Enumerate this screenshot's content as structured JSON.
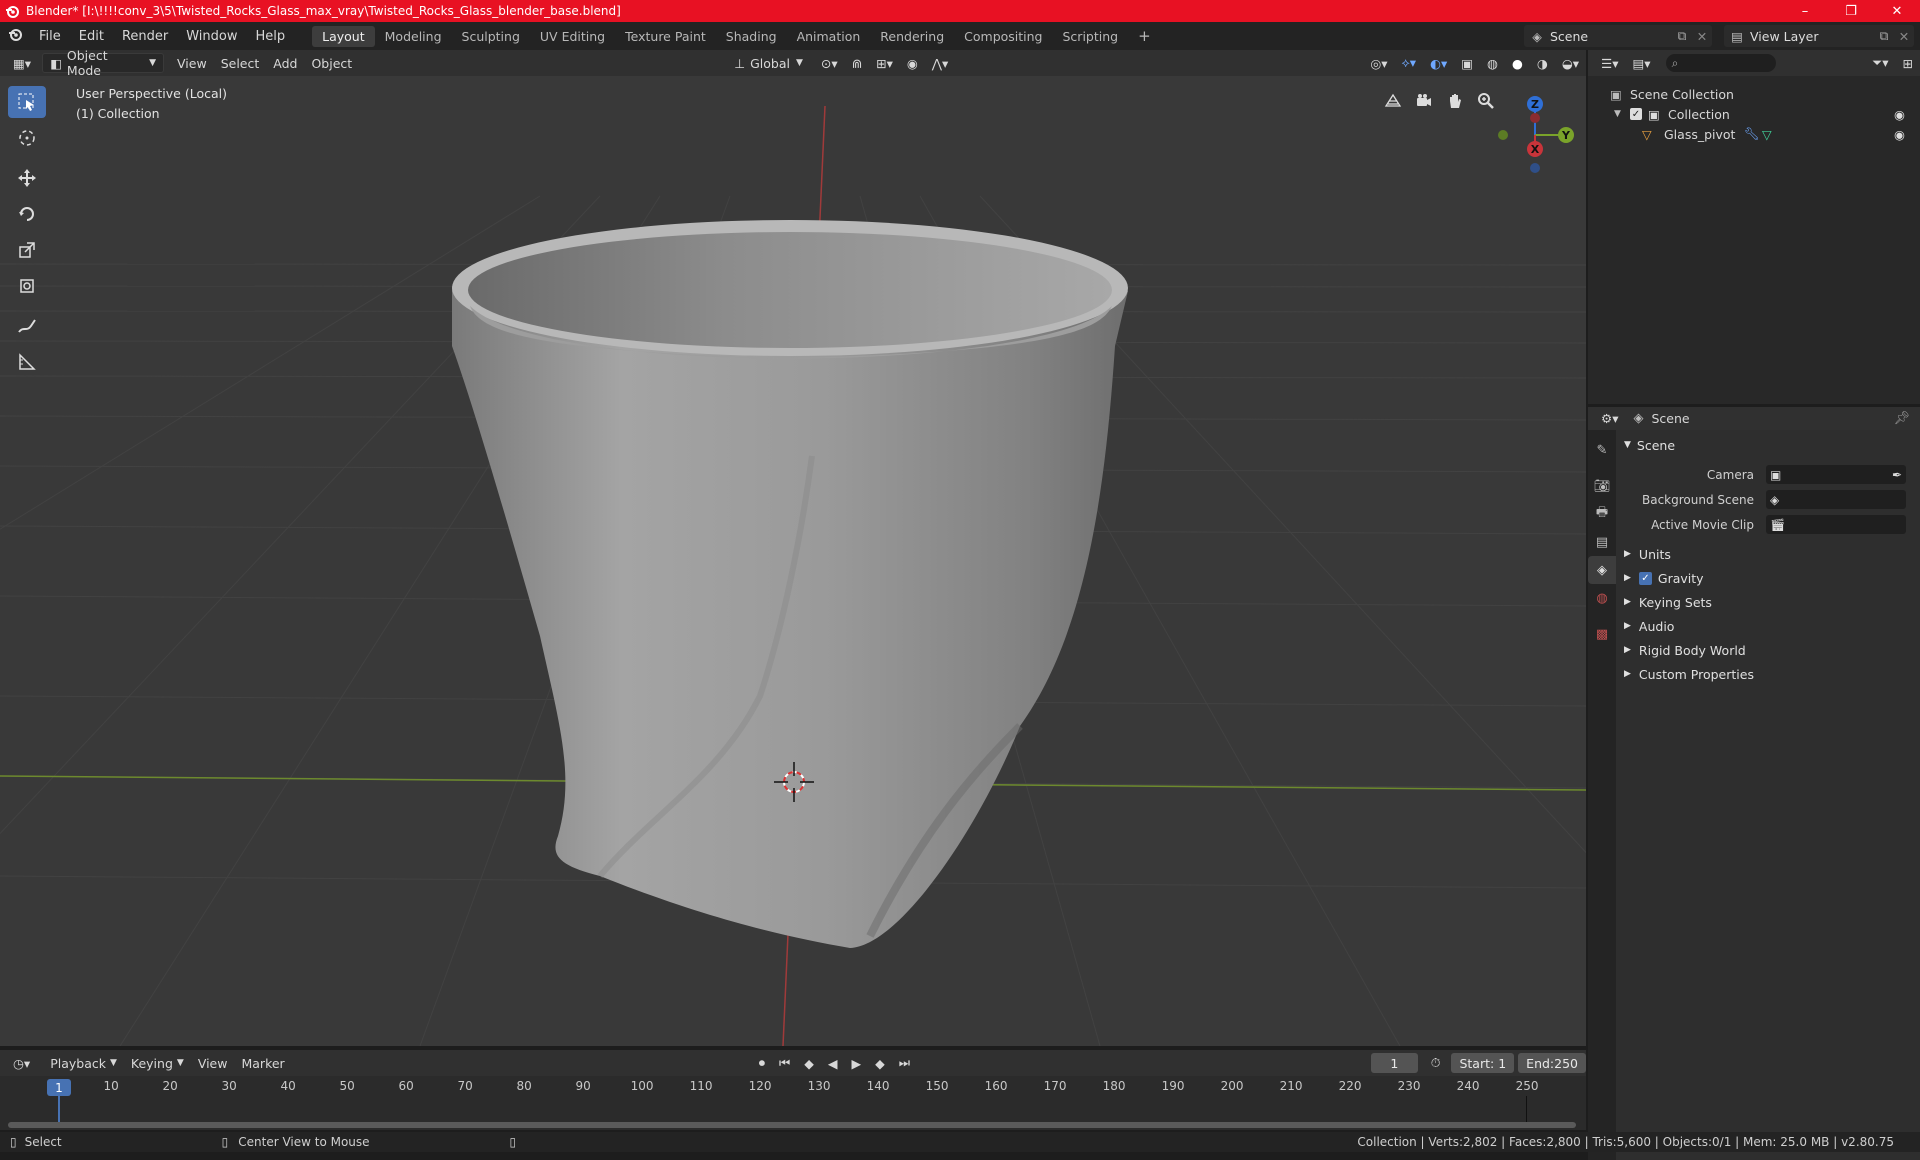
{
  "window": {
    "title": "Blender* [I:\\!!!!conv_3\\5\\Twisted_Rocks_Glass_max_vray\\Twisted_Rocks_Glass_blender_base.blend]",
    "minimize": "–",
    "maximize": "❐",
    "close": "✕"
  },
  "menu": [
    "File",
    "Edit",
    "Render",
    "Window",
    "Help"
  ],
  "workspaces": [
    "Layout",
    "Modeling",
    "Sculpting",
    "UV Editing",
    "Texture Paint",
    "Shading",
    "Animation",
    "Rendering",
    "Compositing",
    "Scripting"
  ],
  "workspace_add": "+",
  "scene_selector": {
    "value": "Scene"
  },
  "view_layer_selector": {
    "value": "View Layer"
  },
  "viewport_header": {
    "mode": "Object Mode",
    "menus": [
      "View",
      "Select",
      "Add",
      "Object"
    ],
    "transform_orientation": "Global"
  },
  "viewport": {
    "perspective_label": "User Perspective (Local)",
    "collection_label": "(1) Collection",
    "gizmo": {
      "z": "Z",
      "y": "Y",
      "x": "X"
    }
  },
  "outliner": {
    "root": "Scene Collection",
    "collection": "Collection",
    "object": "Glass_pivot"
  },
  "properties": {
    "header": "Scene",
    "section": "Scene",
    "fields": [
      {
        "label": "Camera"
      },
      {
        "label": "Background Scene"
      },
      {
        "label": "Active Movie Clip"
      }
    ],
    "subsections": [
      "Units",
      "Gravity",
      "Keying Sets",
      "Audio",
      "Rigid Body World",
      "Custom Properties"
    ]
  },
  "timeline": {
    "menus": [
      "Playback",
      "Keying",
      "View",
      "Marker"
    ],
    "current_frame": "1",
    "start_label": "Start:",
    "start": "1",
    "end_label": "End:",
    "end": "250",
    "ruler": [
      "1",
      "10",
      "20",
      "30",
      "40",
      "50",
      "60",
      "70",
      "80",
      "90",
      "100",
      "110",
      "120",
      "130",
      "140",
      "150",
      "160",
      "170",
      "180",
      "190",
      "200",
      "210",
      "220",
      "230",
      "240",
      "250"
    ]
  },
  "status": {
    "select": "Select",
    "center": "Center View to Mouse",
    "stats": "Collection | Verts:2,802 | Faces:2,800 | Tris:5,600 | Objects:0/1 | Mem: 25.0 MB | v2.80.75"
  },
  "colors": {
    "accent": "#4772b3",
    "title_bar": "#e81123",
    "x_axis": "#c8343a",
    "y_axis": "#7aa32a",
    "z_axis": "#2f6fd6"
  }
}
